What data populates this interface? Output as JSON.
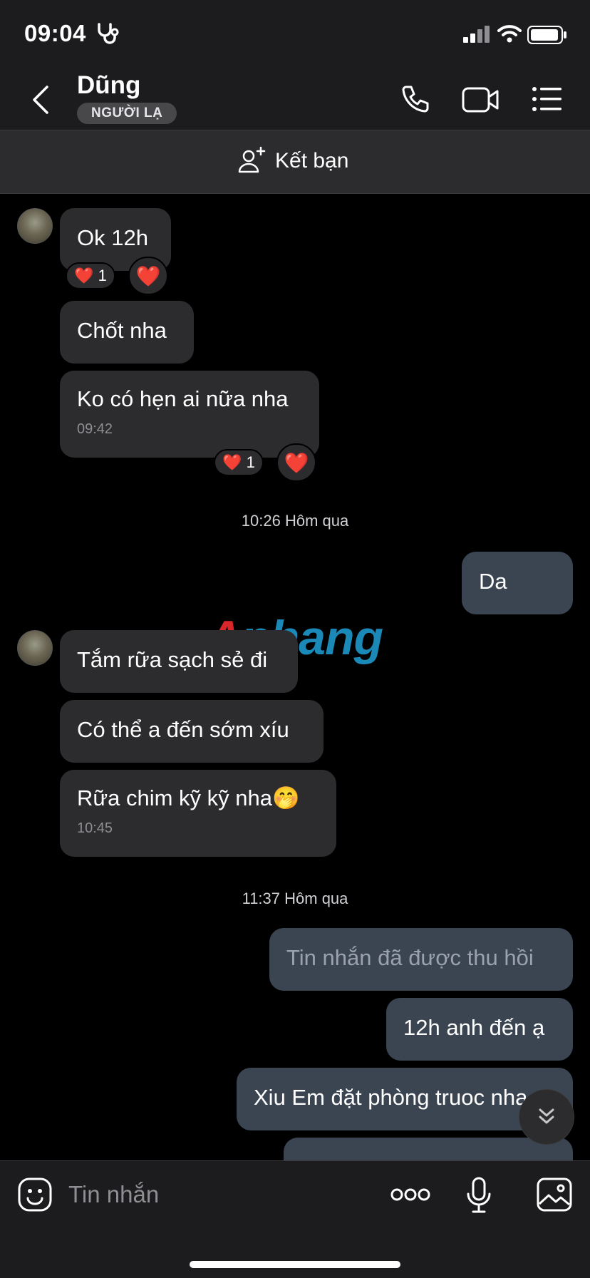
{
  "status_bar": {
    "time": "09:04"
  },
  "header": {
    "contact_name": "Dũng",
    "badge": "NGƯỜI LẠ"
  },
  "friend_bar": {
    "label": "Kết bạn"
  },
  "messages": [
    {
      "text": "Ok 12h"
    },
    {
      "text": "Chốt nha"
    },
    {
      "text": "Ko có hẹn ai nữa nha",
      "time": "09:42"
    },
    {
      "text": "Da"
    },
    {
      "text": "Tắm rữa sạch sẻ đi"
    },
    {
      "text": "Có thể a đến sớm xíu"
    },
    {
      "text": "Rữa chim kỹ kỹ nha🤭",
      "time": "10:45"
    },
    {
      "text": "Tin nhắn đã được thu hồi"
    },
    {
      "text": "12h anh đến ạ"
    },
    {
      "text": "Xiu Em đặt phòng truoc nha"
    }
  ],
  "reactions": [
    {
      "emoji": "❤️",
      "count": "1"
    },
    {
      "emoji": "❤️"
    },
    {
      "emoji": "❤️",
      "count": "1"
    },
    {
      "emoji": "❤️"
    }
  ],
  "dividers": [
    "10:26 Hôm qua",
    "11:37 Hôm qua"
  ],
  "watermark": {
    "part1": "A",
    "part2": "phang"
  },
  "input": {
    "placeholder": "Tin nhắn"
  },
  "colors": {
    "incoming_bubble": "#2c2c2e",
    "outgoing_bubble": "#3b4552",
    "background": "#000000"
  },
  "icons": [
    "back-icon",
    "phone-icon",
    "video-icon",
    "menu-icon",
    "add-friend-icon",
    "emoji-icon",
    "more-icon",
    "microphone-icon",
    "image-icon",
    "scroll-down-icon",
    "wifi-icon",
    "battery-icon",
    "signal-icon",
    "stethoscope-icon"
  ]
}
